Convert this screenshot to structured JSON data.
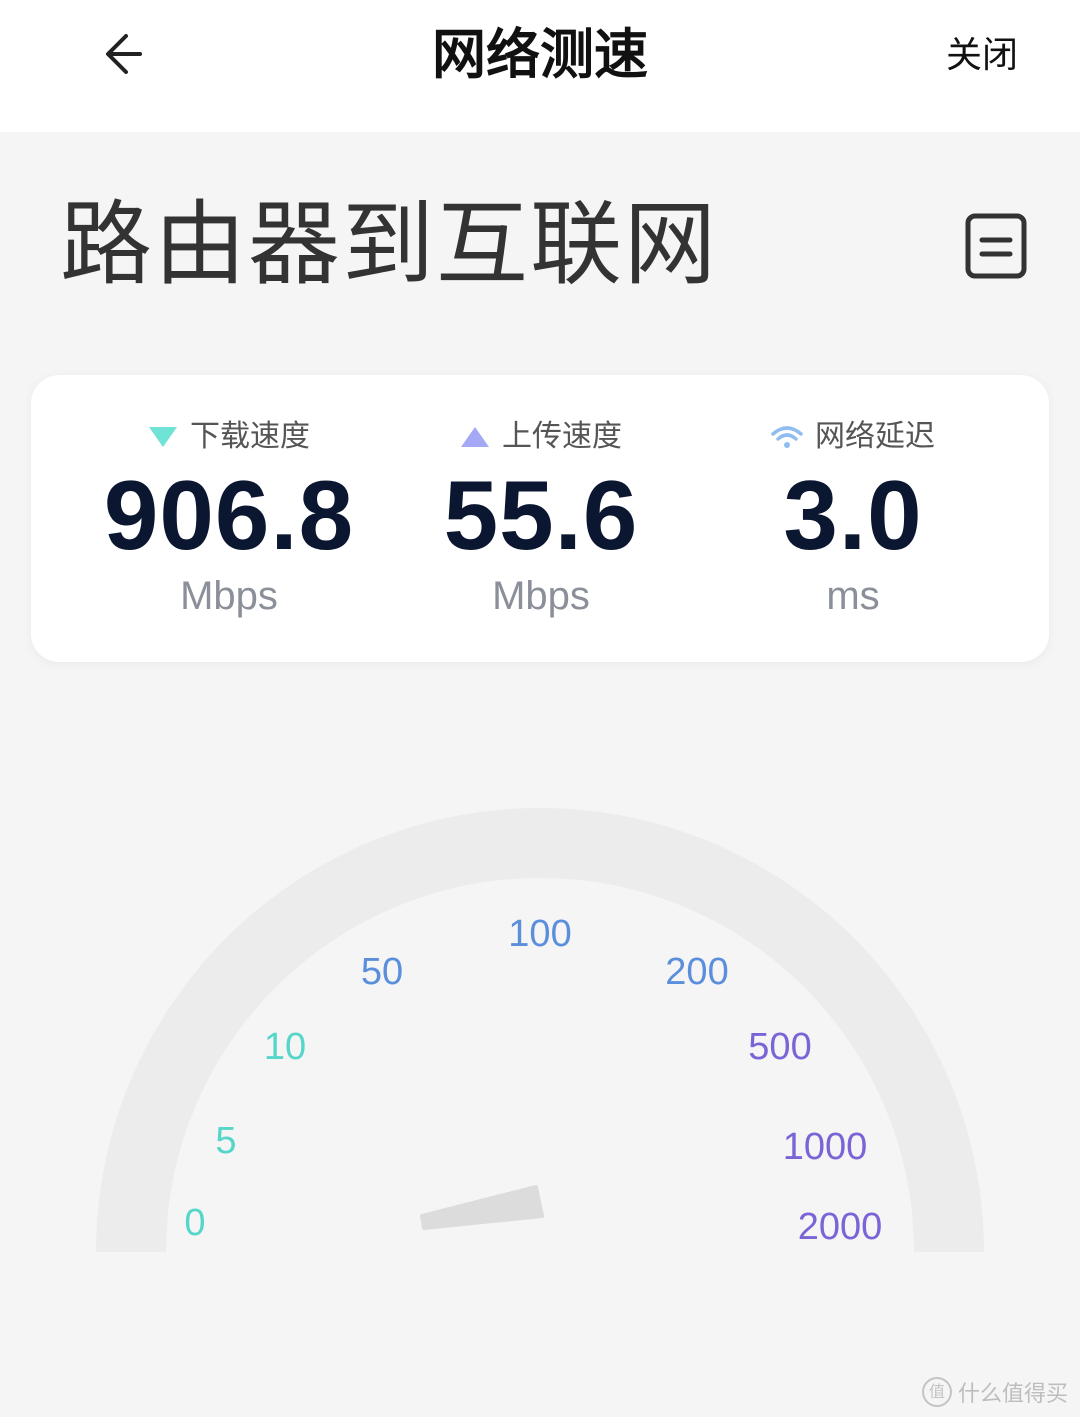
{
  "header": {
    "title": "网络测速",
    "close_label": "关闭"
  },
  "section": {
    "title": "路由器到互联网"
  },
  "metrics": [
    {
      "label": "下载速度",
      "value": "906.8",
      "unit": "Mbps",
      "icon": "triangle-down-icon",
      "color": "#6ee3d6"
    },
    {
      "label": "上传速度",
      "value": "55.6",
      "unit": "Mbps",
      "icon": "triangle-up-icon",
      "color": "#a4a8f5"
    },
    {
      "label": "网络延迟",
      "value": "3.0",
      "unit": "ms",
      "icon": "wifi-icon",
      "color": "#8fbdf0"
    }
  ],
  "gauge": {
    "ticks": [
      "0",
      "5",
      "10",
      "50",
      "100",
      "200",
      "500",
      "1000",
      "2000"
    ],
    "tick_colors": [
      "#56d6c9",
      "#56d6c9",
      "#56d6c9",
      "#5b8fdc",
      "#5b8fdc",
      "#5b8fdc",
      "#7b64d6",
      "#7b64d6",
      "#7b64d6"
    ],
    "track_color": "#ececec",
    "needle_color": "#dcdcdc"
  },
  "watermark": {
    "badge": "值",
    "text": "什么值得买"
  }
}
